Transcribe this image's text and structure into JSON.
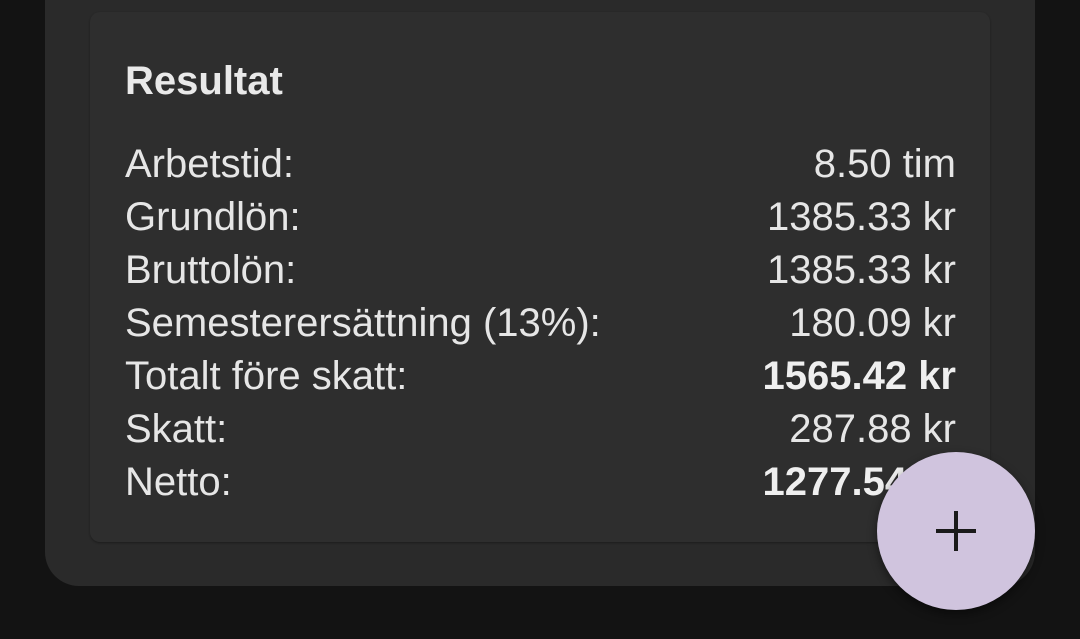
{
  "result_card": {
    "title": "Resultat",
    "rows": [
      {
        "label": "Arbetstid:",
        "value": "8.50 tim",
        "bold": false
      },
      {
        "label": "Grundlön:",
        "value": "1385.33 kr",
        "bold": false
      },
      {
        "label": "Bruttolön:",
        "value": "1385.33 kr",
        "bold": false
      },
      {
        "label": "Semesterersättning (13%):",
        "value": "180.09 kr",
        "bold": false
      },
      {
        "label": "Totalt före skatt:",
        "value": "1565.42 kr",
        "bold": true
      },
      {
        "label": "Skatt:",
        "value": "287.88 kr",
        "bold": false
      },
      {
        "label": "Netto:",
        "value": "1277.54 kr",
        "bold": true
      }
    ]
  },
  "fab": {
    "icon": "plus-icon"
  },
  "colors": {
    "background": "#131313",
    "outer_card": "#2a2a2a",
    "inner_card": "#2e2e2e",
    "text": "#e6e6e6",
    "fab": "#d0c4de"
  }
}
